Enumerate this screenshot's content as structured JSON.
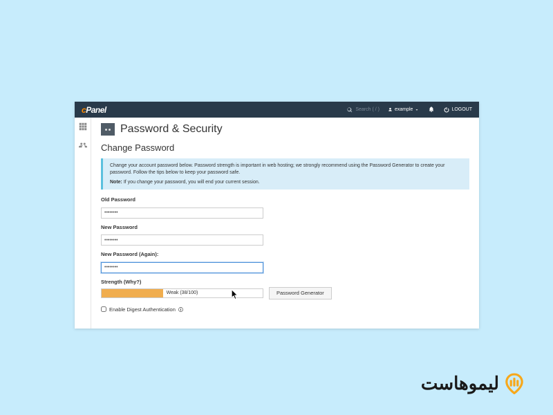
{
  "topbar": {
    "logo_text": "cPanel",
    "search_placeholder": "Search ( / )",
    "username": "example",
    "logout_label": "LOGOUT"
  },
  "page": {
    "title": "Password & Security",
    "section": "Change Password"
  },
  "info": {
    "text": "Change your account password below. Password strength is important in web hosting; we strongly recommend using the Password Generator to create your password. Follow the tips below to keep your password safe.",
    "note_prefix": "Note:",
    "note_text": "If you change your password, you will end your current session."
  },
  "fields": {
    "old_label": "Old Password",
    "old_value": "••••••••",
    "new_label": "New Password",
    "new_value": "••••••••",
    "again_label": "New Password (Again):",
    "again_value": "••••••••"
  },
  "strength": {
    "label": "Strength (Why?)",
    "text": "Weak (38/100)",
    "percent": 38,
    "color": "#f0ad4e"
  },
  "buttons": {
    "generator": "Password Generator"
  },
  "checkbox": {
    "label": "Enable Digest Authentication"
  },
  "watermark": {
    "text": "لیموهاست"
  }
}
